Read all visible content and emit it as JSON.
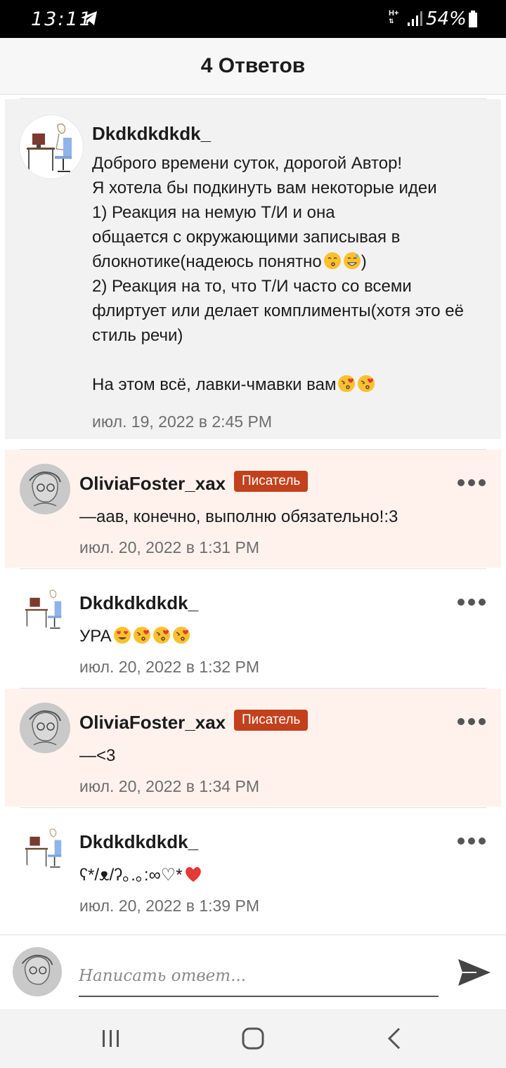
{
  "status_bar": {
    "time": "13:11",
    "network": "H+",
    "battery": "54%"
  },
  "header": {
    "title": "4 Ответов"
  },
  "parent_comment": {
    "username": "Dkdkdkdkdk_",
    "text": "Доброго времени суток, дорогой Автор! \nЯ хотела бы подкинуть вам некоторые идеи\n1) Реакция на немую Т/И и она\nобщается с окружающими записывая в\nблокнотике(надеюсь понятно",
    "text_end": ")\n2) Реакция на то, что Т/И часто со всеми\nфлиртует или делает комплименты(хотя это её\nстиль речи)\n\nНа этом всё, лавки-чмавки вам",
    "date": "июл. 19, 2022 в 2:45 PM"
  },
  "replies": [
    {
      "username": "OliviaFoster_xax",
      "badge": "Писатель",
      "text": "—аав, конечно, выполню обязательно!:3",
      "date": "июл. 20, 2022 в 1:31 PM"
    },
    {
      "username": "Dkdkdkdkdk_",
      "text": "УРА",
      "date": "июл. 20, 2022 в 1:32 PM"
    },
    {
      "username": "OliviaFoster_xax",
      "badge": "Писатель",
      "text": "—<3",
      "date": "июл. 20, 2022 в 1:34 PM"
    },
    {
      "username": "Dkdkdkdkdk_",
      "text": "ʕ*/ᴥ/ʔ｡.｡:∞♡*",
      "date": "июл. 20, 2022 в 1:39 PM"
    }
  ],
  "composer": {
    "placeholder": "Написать ответ..."
  },
  "colors": {
    "badge": "#c2411c",
    "highlight": "#fff2ed",
    "parent_bg": "#f2f2f2"
  },
  "icons": [
    "telegram-icon",
    "signal-icon",
    "battery-icon",
    "more-icon",
    "send-icon",
    "recent-apps-icon",
    "home-icon",
    "back-icon"
  ]
}
